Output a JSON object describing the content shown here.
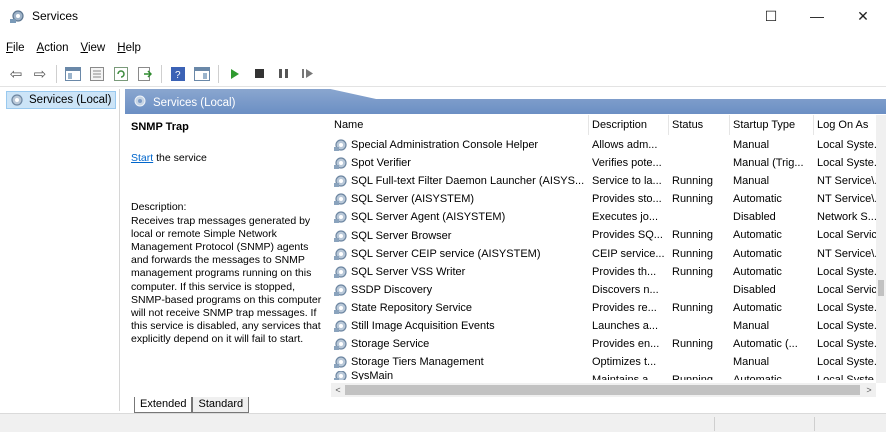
{
  "window": {
    "title": "Services",
    "minimize_glyph": "—",
    "maximize_glyph": "☐",
    "close_glyph": "✕"
  },
  "menu": [
    {
      "label": "File",
      "mnemonic": "F",
      "rest": "ile"
    },
    {
      "label": "Action",
      "mnemonic": "A",
      "rest": "ction"
    },
    {
      "label": "View",
      "mnemonic": "V",
      "rest": "iew"
    },
    {
      "label": "Help",
      "mnemonic": "H",
      "rest": "elp"
    }
  ],
  "toolbar": {
    "icons": [
      "back-icon",
      "forward-icon",
      "show-hide-tree-icon",
      "properties-icon",
      "refresh-icon",
      "export-list-icon",
      "help-icon",
      "show-hide-action-pane-icon",
      "start-service-icon",
      "stop-service-icon",
      "pause-service-icon",
      "resume-service-icon"
    ],
    "back": "⇦",
    "forward": "⇨"
  },
  "tree": {
    "selected_item": "Services (Local)"
  },
  "panel": {
    "title": "Services (Local)"
  },
  "description_pane": {
    "service_name": "SNMP Trap",
    "start_link": "Start",
    "start_suffix": " the service",
    "description_label": "Description:",
    "description_text": "Receives trap messages generated by local or remote Simple Network Management Protocol (SNMP) agents and forwards the messages to SNMP management programs running on this computer. If this service is stopped, SNMP-based programs on this computer will not receive SNMP trap messages. If this service is disabled, any services that explicitly depend on it will fail to start."
  },
  "table": {
    "columns": [
      "Name",
      "Description",
      "Status",
      "Startup Type",
      "Log On As"
    ],
    "rows": [
      {
        "name": "Special Administration Console Helper",
        "description": "Allows adm...",
        "status": "",
        "startup": "Manual",
        "logon": "Local Syste..."
      },
      {
        "name": "Spot Verifier",
        "description": "Verifies pote...",
        "status": "",
        "startup": "Manual (Trig...",
        "logon": "Local Syste..."
      },
      {
        "name": "SQL Full-text Filter Daemon Launcher (AISYS...",
        "description": "Service to la...",
        "status": "Running",
        "startup": "Manual",
        "logon": "NT Service\\..."
      },
      {
        "name": "SQL Server (AISYSTEM)",
        "description": "Provides sto...",
        "status": "Running",
        "startup": "Automatic",
        "logon": "NT Service\\..."
      },
      {
        "name": "SQL Server Agent (AISYSTEM)",
        "description": "Executes jo...",
        "status": "",
        "startup": "Disabled",
        "logon": "Network S..."
      },
      {
        "name": "SQL Server Browser",
        "description": "Provides SQ...",
        "status": "Running",
        "startup": "Automatic",
        "logon": "Local Service"
      },
      {
        "name": "SQL Server CEIP service (AISYSTEM)",
        "description": "CEIP service...",
        "status": "Running",
        "startup": "Automatic",
        "logon": "NT Service\\..."
      },
      {
        "name": "SQL Server VSS Writer",
        "description": "Provides th...",
        "status": "Running",
        "startup": "Automatic",
        "logon": "Local Syste..."
      },
      {
        "name": "SSDP Discovery",
        "description": "Discovers n...",
        "status": "",
        "startup": "Disabled",
        "logon": "Local Service"
      },
      {
        "name": "State Repository Service",
        "description": "Provides re...",
        "status": "Running",
        "startup": "Automatic",
        "logon": "Local Syste..."
      },
      {
        "name": "Still Image Acquisition Events",
        "description": "Launches a...",
        "status": "",
        "startup": "Manual",
        "logon": "Local Syste..."
      },
      {
        "name": "Storage Service",
        "description": "Provides en...",
        "status": "Running",
        "startup": "Automatic (...",
        "logon": "Local Syste..."
      },
      {
        "name": "Storage Tiers Management",
        "description": "Optimizes t...",
        "status": "",
        "startup": "Manual",
        "logon": "Local Syste..."
      },
      {
        "name": "SysMain",
        "description": "Maintains a...",
        "status": "Running",
        "startup": "Automatic",
        "logon": "Local Syste..."
      }
    ]
  },
  "tabs": [
    "Extended",
    "Standard"
  ],
  "colors": {
    "header_gradient_top": "#8aa6cf",
    "header_gradient_bottom": "#6b8fc4",
    "link": "#0066cc",
    "selection_bg": "#cce4f7"
  }
}
